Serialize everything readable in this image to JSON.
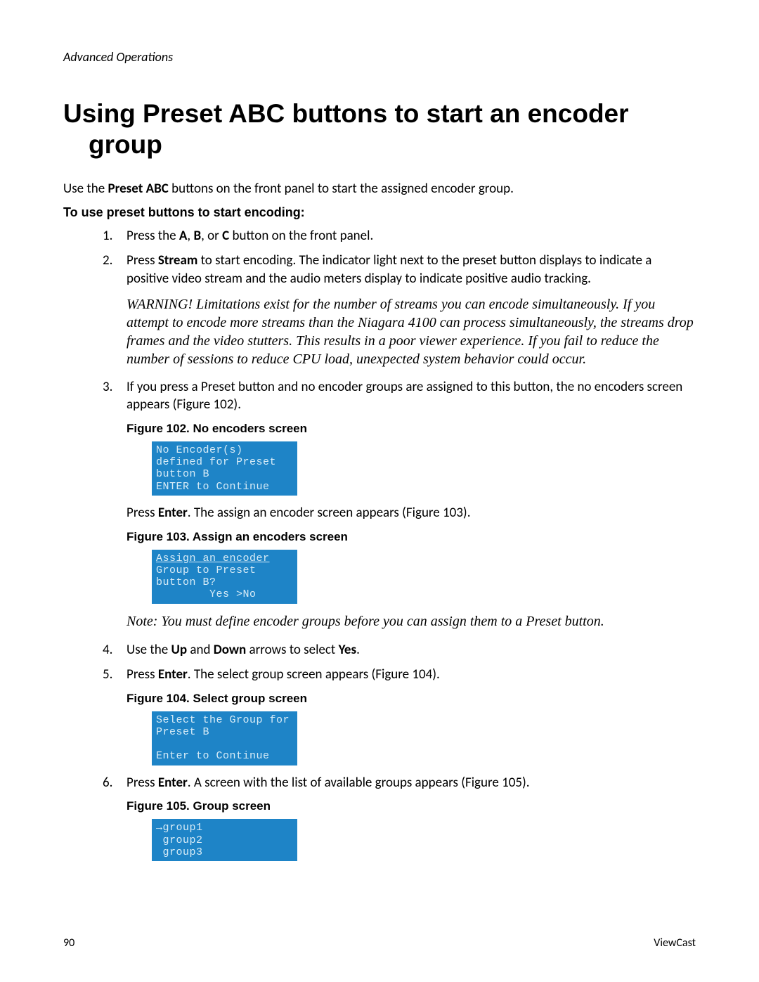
{
  "running_head": "Advanced Operations",
  "title": "Using Preset ABC buttons to start an encoder group",
  "intro_pre": "Use the ",
  "intro_bold": "Preset ABC",
  "intro_post": " buttons on the front panel to start the assigned encoder group.",
  "subhead": "To use preset buttons to start encoding:",
  "step1_num": "1.",
  "step1_a": "Press the ",
  "step1_b1": "A",
  "step1_c": ", ",
  "step1_b2": "B",
  "step1_d": ", or ",
  "step1_b3": "C",
  "step1_e": " button on the front panel.",
  "step2_num": "2.",
  "step2_a": "Press ",
  "step2_b": "Stream",
  "step2_c": " to start encoding. The indicator light next to the preset button displays to indicate a positive video stream and the audio meters display to indicate positive audio tracking.",
  "warn_lead": "WARNING!  ",
  "warn_rest": "Limitations exist for the number of streams you can encode simultaneously. If you attempt to encode more streams than the Niagara 4100 can process simultaneously, the streams drop frames and the video stutters. This results in a poor viewer experience. If you fail to reduce the number of sessions to reduce CPU load, unexpected system behavior could occur.",
  "step3_num": "3.",
  "step3_text": "If you press a Preset button and no encoder groups are assigned to this button, the no encoders screen appears (Figure 102).",
  "fig102_cap": "Figure 102. No encoders screen",
  "fig102_lcd": "No Encoder(s)\ndefined for Preset\nbutton B\nENTER to Continue",
  "after102_a": "Press ",
  "after102_b": "Enter",
  "after102_c": ". The assign an encoder screen appears (Figure 103).",
  "fig103_cap": "Figure 103. Assign an encoders screen",
  "fig103_line1": "Assign an encoder",
  "fig103_line2": "Group to Preset\nbutton B?\n        Yes >No",
  "note_text": "Note: You must define encoder groups before you can assign them to a Preset button.",
  "step4_num": "4.",
  "step4_a": "Use the ",
  "step4_b1": "Up",
  "step4_c": " and ",
  "step4_b2": "Down",
  "step4_d": " arrows to select ",
  "step4_b3": "Yes",
  "step4_e": ".",
  "step5_num": "5.",
  "step5_a": "Press ",
  "step5_b": "Enter",
  "step5_c": ". The select group screen appears (Figure 104).",
  "fig104_cap": "Figure 104. Select group screen",
  "fig104_lcd": "Select the Group for\nPreset B\n\nEnter to Continue",
  "step6_num": "6.",
  "step6_a": "Press ",
  "step6_b": "Enter",
  "step6_c": ". A screen with the list of available groups appears (Figure 105).",
  "fig105_cap": "Figure 105. Group screen",
  "fig105_lcd": "→group1\n group2\n group3",
  "footer_left": "90",
  "footer_right": "ViewCast"
}
